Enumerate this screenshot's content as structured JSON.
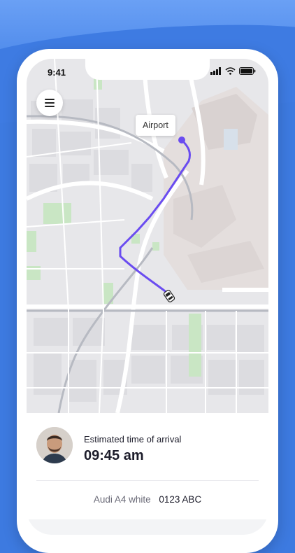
{
  "status_bar": {
    "time": "9:41"
  },
  "map": {
    "destination_label": "Airport",
    "route_color": "#6a4cf0"
  },
  "trip": {
    "eta_label": "Estimated time of arrival",
    "eta_value": "09:45 am",
    "car_model": "Audi A4 white",
    "car_plate": "0123 ABC"
  },
  "icons": [
    "menu-icon",
    "signal-icon",
    "wifi-icon",
    "battery-icon",
    "car-icon",
    "destination-pin-icon"
  ],
  "colors": {
    "background": "#3d7ae0",
    "text_dark": "#1d1d2b",
    "text_muted": "#6b6b78"
  }
}
